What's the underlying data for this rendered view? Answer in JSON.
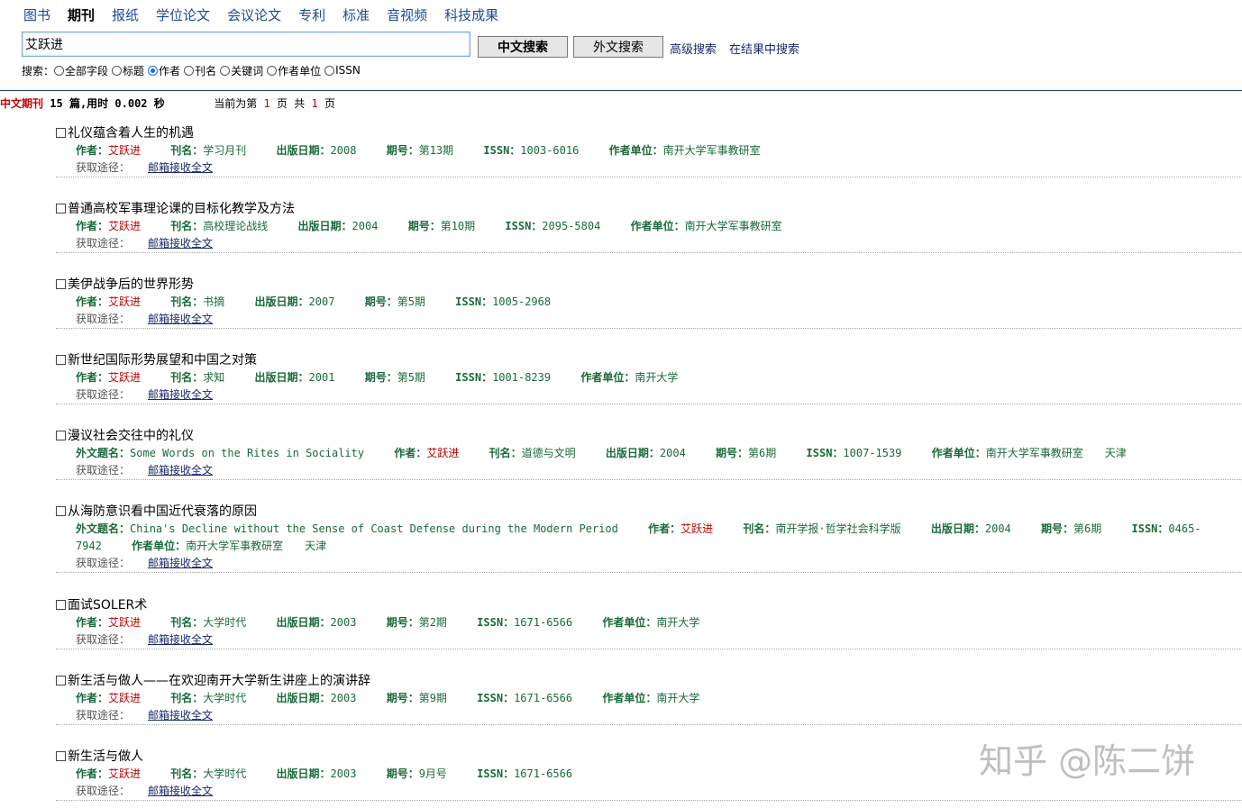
{
  "tabs": [
    "图书",
    "期刊",
    "报纸",
    "学位论文",
    "会议论文",
    "专利",
    "标准",
    "音视频",
    "科技成果"
  ],
  "active_tab": 1,
  "search": {
    "value": "艾跃进",
    "cn_button": "中文搜索",
    "en_button": "外文搜索",
    "advanced": "高级搜索",
    "within": "在结果中搜索",
    "scope_label": "搜索：",
    "options": [
      "全部字段",
      "标题",
      "作者",
      "刊名",
      "关键词",
      "作者单位",
      "ISSN"
    ],
    "selected_option": 2
  },
  "stats": {
    "category": "中文期刊",
    "count": "15",
    "unit": "篇,用时",
    "time": "0.002",
    "time_unit": "秒",
    "page_prefix": "当前为第",
    "page": "1",
    "page_mid": "页 共",
    "total_pages": "1",
    "page_suffix": "页"
  },
  "access_label": "获取途径：",
  "access_link": "邮箱接收全文",
  "results": [
    {
      "title": "礼仪蕴含着人生的机遇",
      "fields": [
        [
          "作者：",
          "艾跃进"
        ],
        [
          "刊名：",
          "学习月刊"
        ],
        [
          "出版日期：",
          "2008"
        ],
        [
          "期号：",
          "第13期"
        ],
        [
          "ISSN：",
          "1003-6016"
        ],
        [
          "作者单位：",
          "南开大学军事教研室"
        ]
      ]
    },
    {
      "title": "普通高校军事理论课的目标化教学及方法",
      "fields": [
        [
          "作者：",
          "艾跃进"
        ],
        [
          "刊名：",
          "高校理论战线"
        ],
        [
          "出版日期：",
          "2004"
        ],
        [
          "期号：",
          "第10期"
        ],
        [
          "ISSN：",
          "2095-5804"
        ],
        [
          "作者单位：",
          "南开大学军事教研室"
        ]
      ]
    },
    {
      "title": "美伊战争后的世界形势",
      "fields": [
        [
          "作者：",
          "艾跃进"
        ],
        [
          "刊名：",
          "书摘"
        ],
        [
          "出版日期：",
          "2007"
        ],
        [
          "期号：",
          "第5期"
        ],
        [
          "ISSN：",
          "1005-2968"
        ]
      ]
    },
    {
      "title": "新世纪国际形势展望和中国之对策",
      "fields": [
        [
          "作者：",
          "艾跃进"
        ],
        [
          "刊名：",
          "求知"
        ],
        [
          "出版日期：",
          "2001"
        ],
        [
          "期号：",
          "第5期"
        ],
        [
          "ISSN：",
          "1001-8239"
        ],
        [
          "作者单位：",
          "南开大学"
        ]
      ]
    },
    {
      "title": "漫议社会交往中的礼仪",
      "fields": [
        [
          "外文题名：",
          "Some Words on the Rites in Sociality"
        ],
        [
          "作者：",
          "艾跃进"
        ],
        [
          "刊名：",
          "道德与文明"
        ],
        [
          "出版日期：",
          "2004"
        ],
        [
          "期号：",
          "第6期"
        ],
        [
          "ISSN：",
          "1007-1539"
        ],
        [
          "作者单位：",
          "南开大学军事教研室　　天津"
        ]
      ]
    },
    {
      "title": "从海防意识看中国近代衰落的原因",
      "fields": [
        [
          "外文题名：",
          "China's Decline without the Sense of Coast Defense during the Modern Period"
        ],
        [
          "作者：",
          "艾跃进"
        ],
        [
          "刊名：",
          "南开学报·哲学社会科学版"
        ],
        [
          "出版日期：",
          "2004"
        ],
        [
          "期号：",
          "第6期"
        ],
        [
          "ISSN：",
          "0465-7942"
        ],
        [
          "作者单位：",
          "南开大学军事教研室　　天津"
        ]
      ]
    },
    {
      "title": "面试SOLER术",
      "fields": [
        [
          "作者：",
          "艾跃进"
        ],
        [
          "刊名：",
          "大学时代"
        ],
        [
          "出版日期：",
          "2003"
        ],
        [
          "期号：",
          "第2期"
        ],
        [
          "ISSN：",
          "1671-6566"
        ],
        [
          "作者单位：",
          "南开大学"
        ]
      ]
    },
    {
      "title": "新生活与做人——在欢迎南开大学新生讲座上的演讲辞",
      "fields": [
        [
          "作者：",
          "艾跃进"
        ],
        [
          "刊名：",
          "大学时代"
        ],
        [
          "出版日期：",
          "2003"
        ],
        [
          "期号：",
          "第9期"
        ],
        [
          "ISSN：",
          "1671-6566"
        ],
        [
          "作者单位：",
          "南开大学"
        ]
      ]
    },
    {
      "title": "新生活与做人",
      "fields": [
        [
          "作者：",
          "艾跃进"
        ],
        [
          "刊名：",
          "大学时代"
        ],
        [
          "出版日期：",
          "2003"
        ],
        [
          "期号：",
          "9月号"
        ],
        [
          "ISSN：",
          "1671-6566"
        ]
      ]
    }
  ],
  "watermark": "知乎 @陈二饼",
  "colors": {
    "label": "#1a6a3a",
    "author": "#c00000",
    "link": "#1a2a6a"
  }
}
